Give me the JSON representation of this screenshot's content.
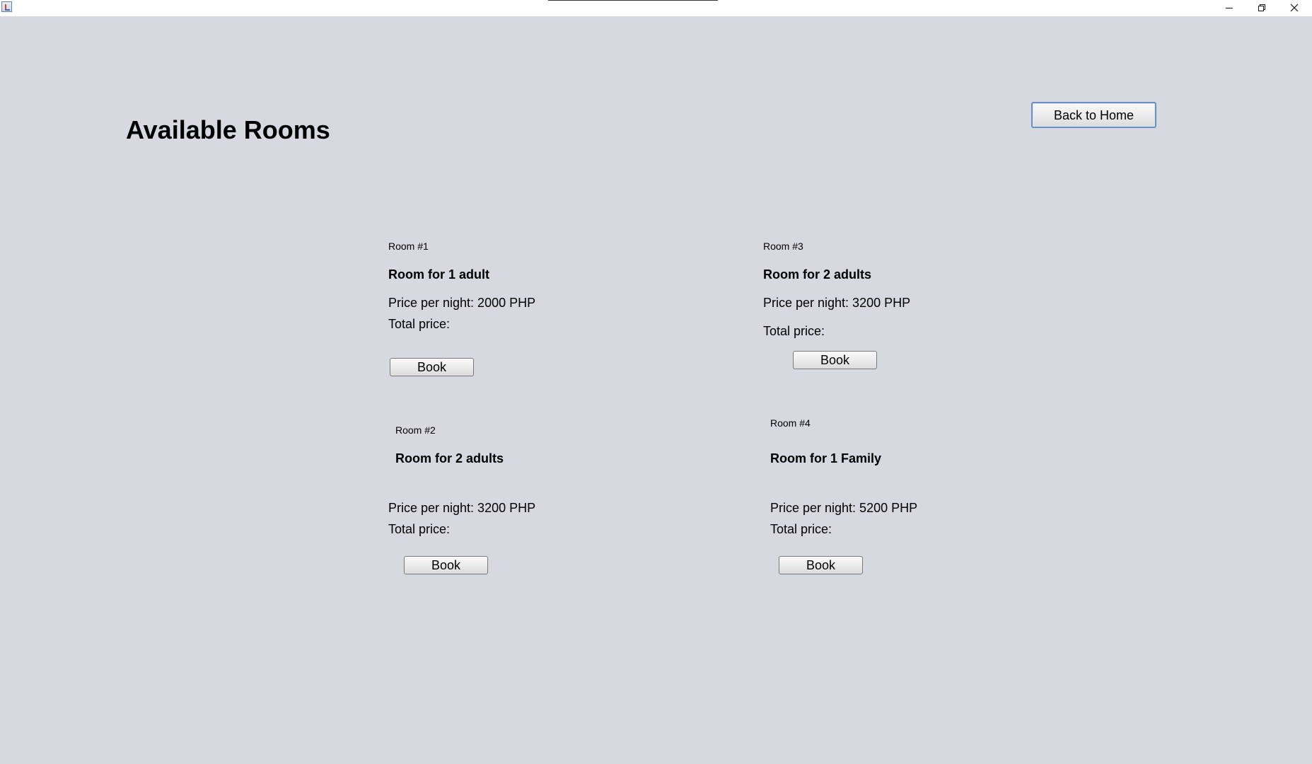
{
  "window": {
    "title": ""
  },
  "page": {
    "title": "Available Rooms",
    "back_button": "Back to Home"
  },
  "rooms": [
    {
      "number": "Room #1",
      "title": "Room for 1 adult",
      "price": "Price per night: 2000 PHP",
      "total": "Total price:",
      "book_label": "Book"
    },
    {
      "number": "Room #2",
      "title": "Room for 2 adults",
      "price": "Price per night: 3200 PHP",
      "total": "Total price:",
      "book_label": "Book"
    },
    {
      "number": "Room #3",
      "title": "Room for 2 adults",
      "price": "Price per night: 3200 PHP",
      "total": "Total price:",
      "book_label": "Book"
    },
    {
      "number": "Room #4",
      "title": "Room for 1 Family",
      "price": "Price per night: 5200 PHP",
      "total": "Total price:",
      "book_label": "Book"
    }
  ],
  "icons": {
    "app": "java-app-icon",
    "minimize": "minimize-icon",
    "restore": "restore-icon",
    "close": "close-icon"
  }
}
